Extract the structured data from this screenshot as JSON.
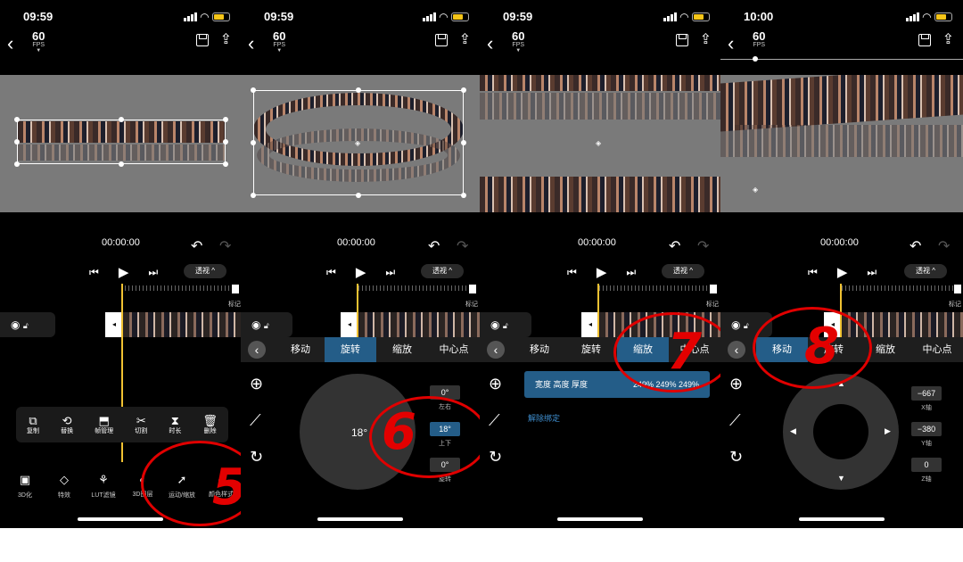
{
  "panels": [
    {
      "time": "09:59",
      "fps_value": "60",
      "fps_unit": "FPS",
      "timecode": "00:00:00",
      "perspective_label": "透视 ^",
      "bookmark_label": "标记",
      "actions": [
        {
          "icon": "copy-icon",
          "label": "复制"
        },
        {
          "icon": "replace-icon",
          "label": "替换"
        },
        {
          "icon": "frame-icon",
          "label": "帧管理"
        },
        {
          "icon": "scissors-icon",
          "label": "切割"
        },
        {
          "icon": "duration-icon",
          "label": "时长"
        },
        {
          "icon": "trash-icon",
          "label": "删除"
        }
      ],
      "bottom_tools": [
        {
          "icon": "3d-icon",
          "label": "3D化"
        },
        {
          "icon": "diamond-icon",
          "label": "特效"
        },
        {
          "icon": "lut-icon",
          "label": "LUT滤镜"
        },
        {
          "icon": "layer-icon",
          "label": "3D图层"
        },
        {
          "icon": "run-icon",
          "label": "运动/缩放"
        },
        {
          "icon": "color-icon",
          "label": "颜色样式"
        }
      ],
      "annotation_number": "5"
    },
    {
      "time": "09:59",
      "fps_value": "60",
      "fps_unit": "FPS",
      "timecode": "00:00:00",
      "perspective_label": "透视 ^",
      "bookmark_label": "标记",
      "tabs": [
        "移动",
        "旋转",
        "缩放",
        "中心点"
      ],
      "active_tab": "旋转",
      "dial_value": "18°",
      "rotations": [
        {
          "value": "0°",
          "label": "左右"
        },
        {
          "value": "18°",
          "label": "上下"
        },
        {
          "value": "0°",
          "label": "旋转"
        }
      ],
      "annotation_number": "6"
    },
    {
      "time": "09:59",
      "fps_value": "60",
      "fps_unit": "FPS",
      "timecode": "00:00:00",
      "perspective_label": "透视 ^",
      "bookmark_label": "标记",
      "tabs": [
        "移动",
        "旋转",
        "缩放",
        "中心点"
      ],
      "active_tab": "缩放",
      "scale_label": "宽度 高度 厚度",
      "scale_values": "249% 249% 249%",
      "unbind_label": "解除绑定",
      "annotation_number": "7"
    },
    {
      "time": "10:00",
      "fps_value": "60",
      "fps_unit": "FPS",
      "timecode": "00:00:00",
      "perspective_label": "透视 ^",
      "bookmark_label": "标记",
      "tabs": [
        "移动",
        "旋转",
        "缩放",
        "中心点"
      ],
      "active_tab": "移动",
      "axes": [
        {
          "value": "−667",
          "label": "X轴"
        },
        {
          "value": "−380",
          "label": "Y轴"
        },
        {
          "value": "0",
          "label": "Z轴"
        }
      ],
      "annotation_number": "8"
    }
  ],
  "colors": {
    "accent": "#245d88",
    "playhead": "#f1c232",
    "annotation": "#e30000"
  }
}
